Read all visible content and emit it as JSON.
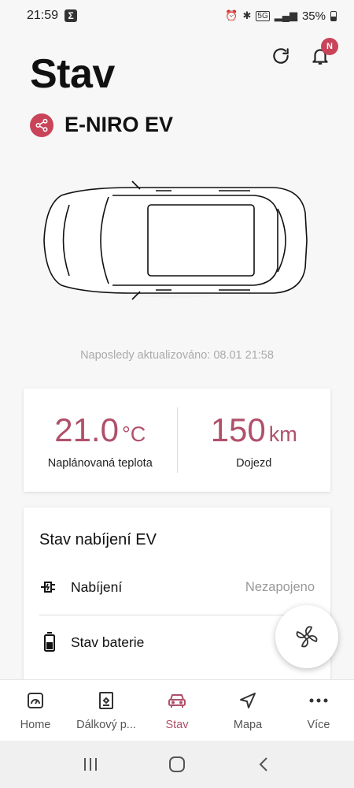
{
  "status_bar": {
    "time": "21:59",
    "app_icon": "Σ",
    "network": "5G",
    "battery": "35%"
  },
  "header": {
    "title": "Stav",
    "notification_badge": "N"
  },
  "vehicle": {
    "name": "E-NIRO EV"
  },
  "last_updated": "Naposledy aktualizováno: 08.01 21:58",
  "stats": {
    "temperature": {
      "value": "21.0",
      "unit": "°C",
      "label": "Naplánovaná teplota"
    },
    "range": {
      "value": "150",
      "unit": "km",
      "label": "Dojezd"
    }
  },
  "charging": {
    "title": "Stav nabíjení EV",
    "rows": [
      {
        "label": "Nabíjení",
        "value": "Nezapojeno"
      },
      {
        "label": "Stav baterie",
        "value": ""
      }
    ]
  },
  "bottom_nav": {
    "items": [
      {
        "label": "Home"
      },
      {
        "label": "Dálkový p..."
      },
      {
        "label": "Stav"
      },
      {
        "label": "Mapa"
      },
      {
        "label": "Více"
      }
    ]
  },
  "colors": {
    "accent": "#b0506a",
    "badge": "#c94459"
  }
}
